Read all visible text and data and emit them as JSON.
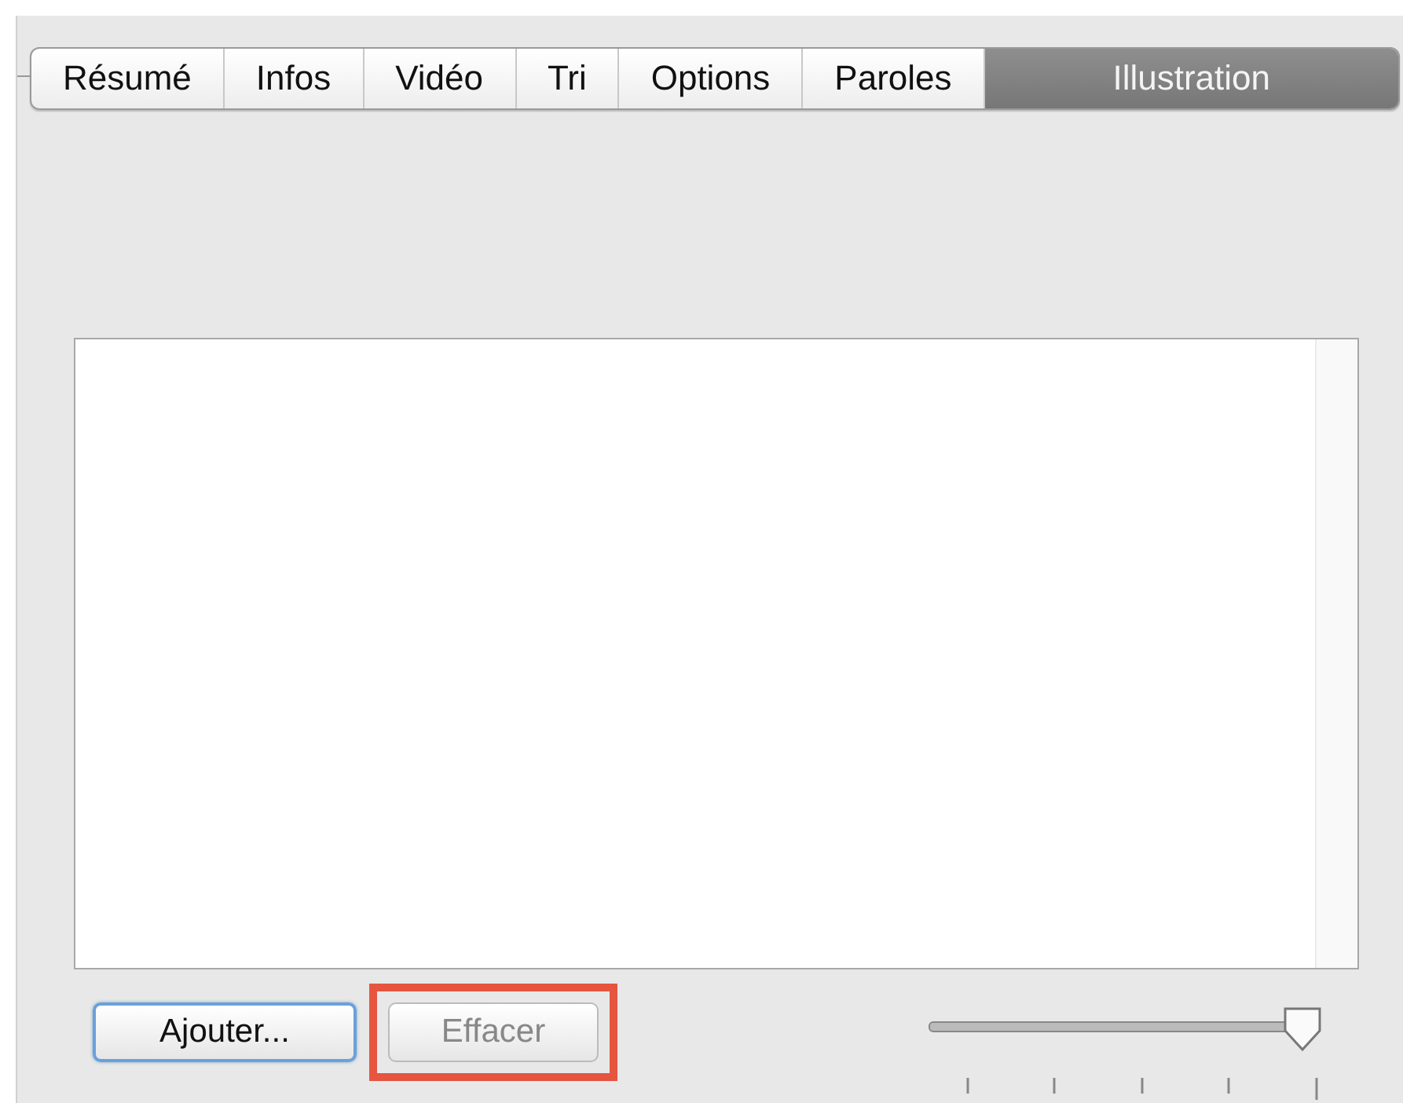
{
  "tabs": [
    {
      "label": "Résumé",
      "selected": false
    },
    {
      "label": "Infos",
      "selected": false
    },
    {
      "label": "Vidéo",
      "selected": false
    },
    {
      "label": "Tri",
      "selected": false
    },
    {
      "label": "Options",
      "selected": false
    },
    {
      "label": "Paroles",
      "selected": false
    },
    {
      "label": "Illustration",
      "selected": true
    }
  ],
  "buttons": [
    {
      "label": "Ajouter...",
      "default": true,
      "disabled": false,
      "highlighted": false
    },
    {
      "label": "Effacer",
      "default": false,
      "disabled": true,
      "highlighted": true
    }
  ],
  "size_slider": {
    "level": 1
  }
}
